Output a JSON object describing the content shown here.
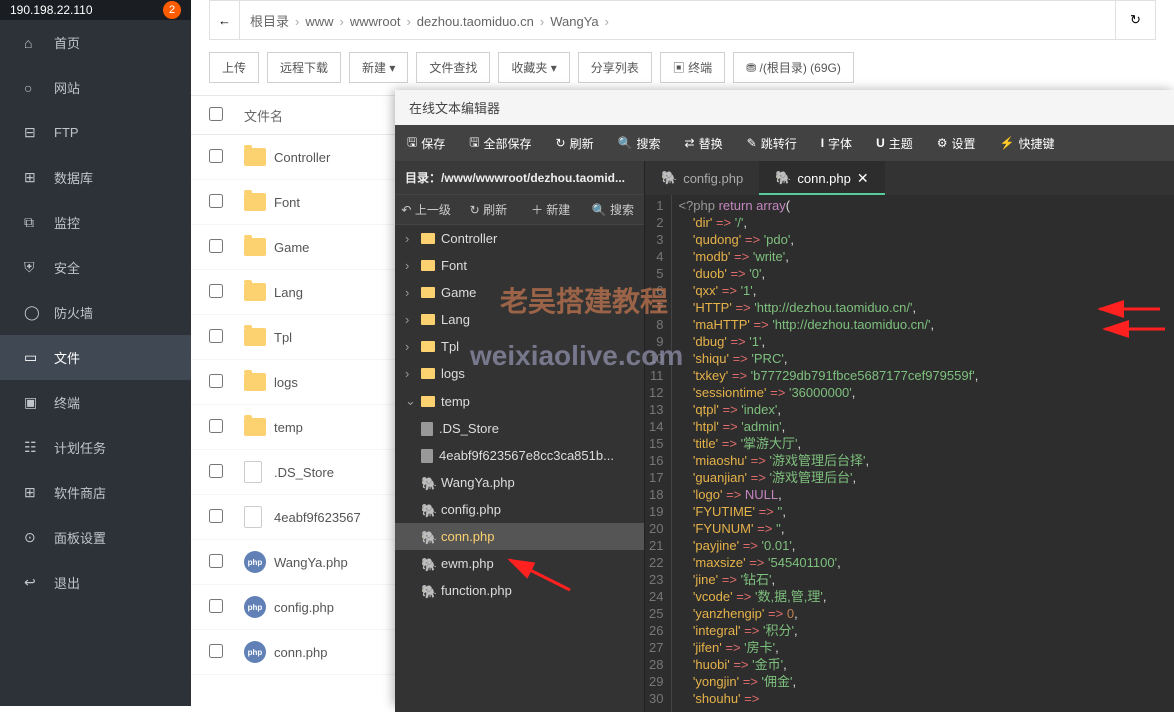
{
  "sidebar": {
    "ip": "190.198.22.110",
    "badge": "2",
    "items": [
      {
        "id": "home",
        "label": "首页",
        "icon": "⌂"
      },
      {
        "id": "site",
        "label": "网站",
        "icon": "○",
        "active": false
      },
      {
        "id": "ftp",
        "label": "FTP",
        "icon": "⊟"
      },
      {
        "id": "db",
        "label": "数据库",
        "icon": "⊞"
      },
      {
        "id": "monitor",
        "label": "监控",
        "icon": "⧉"
      },
      {
        "id": "security",
        "label": "安全",
        "icon": "⛨"
      },
      {
        "id": "firewall",
        "label": "防火墙",
        "icon": "◯"
      },
      {
        "id": "files",
        "label": "文件",
        "icon": "▭",
        "active": true
      },
      {
        "id": "terminal",
        "label": "终端",
        "icon": "▣"
      },
      {
        "id": "cron",
        "label": "计划任务",
        "icon": "☷"
      },
      {
        "id": "soft",
        "label": "软件商店",
        "icon": "⊞"
      },
      {
        "id": "panel",
        "label": "面板设置",
        "icon": "⊙"
      },
      {
        "id": "logout",
        "label": "退出",
        "icon": "↩"
      }
    ]
  },
  "breadcrumb": [
    "根目录",
    "www",
    "wwwroot",
    "dezhou.taomiduo.cn",
    "WangYa"
  ],
  "toolbar": {
    "upload": "上传",
    "remote": "远程下载",
    "new": "新建 ▾",
    "search": "文件查找",
    "fav": "收藏夹 ▾",
    "share": "分享列表",
    "term": "▣ 终端",
    "disk": "⛃ /(根目录) (69G)"
  },
  "cols": {
    "name": "文件名"
  },
  "files": [
    {
      "type": "folder",
      "name": "Controller"
    },
    {
      "type": "folder",
      "name": "Font"
    },
    {
      "type": "folder",
      "name": "Game"
    },
    {
      "type": "folder",
      "name": "Lang"
    },
    {
      "type": "folder",
      "name": "Tpl"
    },
    {
      "type": "folder",
      "name": "logs"
    },
    {
      "type": "folder",
      "name": "temp"
    },
    {
      "type": "file",
      "name": ".DS_Store"
    },
    {
      "type": "file",
      "name": "4eabf9f623567"
    },
    {
      "type": "php",
      "name": "WangYa.php"
    },
    {
      "type": "php",
      "name": "config.php"
    },
    {
      "type": "php",
      "name": "conn.php"
    }
  ],
  "editor": {
    "title": "在线文本编辑器",
    "bar": {
      "save": "保存",
      "saveall": "全部保存",
      "refresh": "刷新",
      "search": "搜索",
      "replace": "替换",
      "goto": "跳转行",
      "font": "字体",
      "theme": "主题",
      "settings": "设置",
      "shortcut": "快捷键"
    },
    "dir": "目录：/www/wwwroot/dezhou.taomid...",
    "tb": {
      "up": "上一级",
      "refresh": "刷新",
      "new": "新建",
      "search": "搜索"
    },
    "tree": [
      {
        "type": "folder",
        "name": "Controller",
        "caret": "›"
      },
      {
        "type": "folder",
        "name": "Font",
        "caret": "›"
      },
      {
        "type": "folder",
        "name": "Game",
        "caret": "›"
      },
      {
        "type": "folder",
        "name": "Lang",
        "caret": "›"
      },
      {
        "type": "folder",
        "name": "Tpl",
        "caret": "›"
      },
      {
        "type": "folder",
        "name": "logs",
        "caret": "›"
      },
      {
        "type": "folder",
        "name": "temp",
        "caret": "⌄"
      },
      {
        "type": "file",
        "name": ".DS_Store"
      },
      {
        "type": "file",
        "name": "4eabf9f623567e8cc3ca851b..."
      },
      {
        "type": "php",
        "name": "WangYa.php"
      },
      {
        "type": "php",
        "name": "config.php"
      },
      {
        "type": "php",
        "name": "conn.php",
        "sel": true
      },
      {
        "type": "php",
        "name": "ewm.php"
      },
      {
        "type": "php",
        "name": "function.php"
      }
    ],
    "tabs": [
      {
        "name": "config.php"
      },
      {
        "name": "conn.php",
        "active": true,
        "close": true
      }
    ],
    "code": [
      [
        [
          "k-tag",
          "<?php "
        ],
        [
          "k-kw",
          "return "
        ],
        [
          "k-kw",
          "array"
        ],
        [
          "",
          ""
        ],
        [
          "",
          "("
        ]
      ],
      [
        [
          "s-dot",
          "    "
        ],
        [
          "k-key",
          "'dir'"
        ],
        [
          "s-dot",
          " "
        ],
        [
          "k-op",
          "=>"
        ],
        [
          "s-dot",
          " "
        ],
        [
          "k-str",
          "'/'"
        ],
        [
          "",
          ","
        ]
      ],
      [
        [
          "s-dot",
          "    "
        ],
        [
          "k-key",
          "'qudong'"
        ],
        [
          "s-dot",
          " "
        ],
        [
          "k-op",
          "=>"
        ],
        [
          "s-dot",
          " "
        ],
        [
          "k-str",
          "'pdo'"
        ],
        [
          "",
          ","
        ]
      ],
      [
        [
          "s-dot",
          "    "
        ],
        [
          "k-key",
          "'modb'"
        ],
        [
          "s-dot",
          " "
        ],
        [
          "k-op",
          "=>"
        ],
        [
          "s-dot",
          " "
        ],
        [
          "k-str",
          "'write'"
        ],
        [
          "",
          ","
        ]
      ],
      [
        [
          "s-dot",
          "    "
        ],
        [
          "k-key",
          "'duob'"
        ],
        [
          "s-dot",
          " "
        ],
        [
          "k-op",
          "=>"
        ],
        [
          "s-dot",
          " "
        ],
        [
          "k-str",
          "'0'"
        ],
        [
          "",
          ","
        ]
      ],
      [
        [
          "s-dot",
          "    "
        ],
        [
          "k-key",
          "'qxx'"
        ],
        [
          "s-dot",
          " "
        ],
        [
          "k-op",
          "=>"
        ],
        [
          "s-dot",
          " "
        ],
        [
          "k-str",
          "'1'"
        ],
        [
          "",
          ","
        ]
      ],
      [
        [
          "s-dot",
          "    "
        ],
        [
          "k-key",
          "'HTTP'"
        ],
        [
          "s-dot",
          " "
        ],
        [
          "k-op",
          "=>"
        ],
        [
          "s-dot",
          " "
        ],
        [
          "k-str",
          "'http://dezhou.taomiduo.cn/'"
        ],
        [
          "",
          ","
        ]
      ],
      [
        [
          "s-dot",
          "    "
        ],
        [
          "k-key",
          "'maHTTP'"
        ],
        [
          "s-dot",
          " "
        ],
        [
          "k-op",
          "=>"
        ],
        [
          "s-dot",
          " "
        ],
        [
          "k-str",
          "'http://dezhou.taomiduo.cn/'"
        ],
        [
          "",
          ","
        ]
      ],
      [
        [
          "s-dot",
          "    "
        ],
        [
          "k-key",
          "'dbug'"
        ],
        [
          "s-dot",
          " "
        ],
        [
          "k-op",
          "=>"
        ],
        [
          "s-dot",
          " "
        ],
        [
          "k-str",
          "'1'"
        ],
        [
          "",
          ","
        ]
      ],
      [
        [
          "s-dot",
          "    "
        ],
        [
          "k-key",
          "'shiqu'"
        ],
        [
          "s-dot",
          " "
        ],
        [
          "k-op",
          "=>"
        ],
        [
          "s-dot",
          " "
        ],
        [
          "k-str",
          "'PRC'"
        ],
        [
          "",
          ","
        ]
      ],
      [
        [
          "s-dot",
          "    "
        ],
        [
          "k-key",
          "'txkey'"
        ],
        [
          "s-dot",
          " "
        ],
        [
          "k-op",
          "=>"
        ],
        [
          "s-dot",
          " "
        ],
        [
          "k-str",
          "'b77729db791fbce5687177cef979559f'"
        ],
        [
          "",
          ","
        ]
      ],
      [
        [
          "s-dot",
          "    "
        ],
        [
          "k-key",
          "'sessiontime'"
        ],
        [
          "s-dot",
          " "
        ],
        [
          "k-op",
          "=>"
        ],
        [
          "s-dot",
          " "
        ],
        [
          "k-str",
          "'36000000'"
        ],
        [
          "",
          ","
        ]
      ],
      [
        [
          "s-dot",
          "    "
        ],
        [
          "k-key",
          "'qtpl'"
        ],
        [
          "s-dot",
          " "
        ],
        [
          "k-op",
          "=>"
        ],
        [
          "s-dot",
          " "
        ],
        [
          "k-str",
          "'index'"
        ],
        [
          "",
          ","
        ]
      ],
      [
        [
          "s-dot",
          "    "
        ],
        [
          "k-key",
          "'htpl'"
        ],
        [
          "s-dot",
          " "
        ],
        [
          "k-op",
          "=>"
        ],
        [
          "s-dot",
          " "
        ],
        [
          "k-str",
          "'admin'"
        ],
        [
          "",
          ","
        ]
      ],
      [
        [
          "s-dot",
          "    "
        ],
        [
          "k-key",
          "'title'"
        ],
        [
          "s-dot",
          " "
        ],
        [
          "k-op",
          "=>"
        ],
        [
          "s-dot",
          " "
        ],
        [
          "k-str",
          "'掌游大厅'"
        ],
        [
          "",
          ","
        ]
      ],
      [
        [
          "s-dot",
          "    "
        ],
        [
          "k-key",
          "'miaoshu'"
        ],
        [
          "s-dot",
          " "
        ],
        [
          "k-op",
          "=>"
        ],
        [
          "s-dot",
          " "
        ],
        [
          "k-str",
          "'游戏管理后台择'"
        ],
        [
          "",
          ","
        ]
      ],
      [
        [
          "s-dot",
          "    "
        ],
        [
          "k-key",
          "'guanjian'"
        ],
        [
          "s-dot",
          " "
        ],
        [
          "k-op",
          "=>"
        ],
        [
          "s-dot",
          " "
        ],
        [
          "k-str",
          "'游戏管理后台'"
        ],
        [
          "",
          ","
        ]
      ],
      [
        [
          "s-dot",
          "    "
        ],
        [
          "k-key",
          "'logo'"
        ],
        [
          "s-dot",
          " "
        ],
        [
          "k-op",
          "=>"
        ],
        [
          "s-dot",
          " "
        ],
        [
          "k-kw",
          "NULL"
        ],
        [
          "",
          ","
        ]
      ],
      [
        [
          "s-dot",
          "    "
        ],
        [
          "k-key",
          "'FYUTIME'"
        ],
        [
          "s-dot",
          " "
        ],
        [
          "k-op",
          "=>"
        ],
        [
          "s-dot",
          " "
        ],
        [
          "k-str",
          "''"
        ],
        [
          "",
          ","
        ]
      ],
      [
        [
          "s-dot",
          "    "
        ],
        [
          "k-key",
          "'FYUNUM'"
        ],
        [
          "s-dot",
          " "
        ],
        [
          "k-op",
          "=>"
        ],
        [
          "s-dot",
          " "
        ],
        [
          "k-str",
          "''"
        ],
        [
          "",
          ","
        ]
      ],
      [
        [
          "s-dot",
          "    "
        ],
        [
          "k-key",
          "'payjine'"
        ],
        [
          "s-dot",
          " "
        ],
        [
          "k-op",
          "=>"
        ],
        [
          "s-dot",
          " "
        ],
        [
          "k-str",
          "'0.01'"
        ],
        [
          "",
          ","
        ]
      ],
      [
        [
          "s-dot",
          "    "
        ],
        [
          "k-key",
          "'maxsize'"
        ],
        [
          "s-dot",
          " "
        ],
        [
          "k-op",
          "=>"
        ],
        [
          "s-dot",
          " "
        ],
        [
          "k-str",
          "'545401100'"
        ],
        [
          "",
          ","
        ]
      ],
      [
        [
          "s-dot",
          "    "
        ],
        [
          "k-key",
          "'jine'"
        ],
        [
          "s-dot",
          " "
        ],
        [
          "k-op",
          "=>"
        ],
        [
          "s-dot",
          " "
        ],
        [
          "k-str",
          "'钻石'"
        ],
        [
          "",
          ","
        ]
      ],
      [
        [
          "s-dot",
          "    "
        ],
        [
          "k-key",
          "'vcode'"
        ],
        [
          "s-dot",
          " "
        ],
        [
          "k-op",
          "=>"
        ],
        [
          "s-dot",
          " "
        ],
        [
          "k-str",
          "'数,据,管,理'"
        ],
        [
          "",
          ","
        ]
      ],
      [
        [
          "s-dot",
          "    "
        ],
        [
          "k-key",
          "'yanzhengip'"
        ],
        [
          "s-dot",
          " "
        ],
        [
          "k-op",
          "=>"
        ],
        [
          "s-dot",
          " "
        ],
        [
          "k-num",
          "0"
        ],
        [
          "",
          ","
        ]
      ],
      [
        [
          "s-dot",
          "    "
        ],
        [
          "k-key",
          "'integral'"
        ],
        [
          "s-dot",
          " "
        ],
        [
          "k-op",
          "=>"
        ],
        [
          "s-dot",
          " "
        ],
        [
          "k-str",
          "'积分'"
        ],
        [
          "",
          ","
        ]
      ],
      [
        [
          "s-dot",
          "    "
        ],
        [
          "k-key",
          "'jifen'"
        ],
        [
          "s-dot",
          " "
        ],
        [
          "k-op",
          "=>"
        ],
        [
          "s-dot",
          " "
        ],
        [
          "k-str",
          "'房卡'"
        ],
        [
          "",
          ","
        ]
      ],
      [
        [
          "s-dot",
          "    "
        ],
        [
          "k-key",
          "'huobi'"
        ],
        [
          "s-dot",
          " "
        ],
        [
          "k-op",
          "=>"
        ],
        [
          "s-dot",
          " "
        ],
        [
          "k-str",
          "'金币'"
        ],
        [
          "",
          ","
        ]
      ],
      [
        [
          "s-dot",
          "    "
        ],
        [
          "k-key",
          "'yongjin'"
        ],
        [
          "s-dot",
          " "
        ],
        [
          "k-op",
          "=>"
        ],
        [
          "s-dot",
          " "
        ],
        [
          "k-str",
          "'佣金'"
        ],
        [
          "",
          ","
        ]
      ],
      [
        [
          "s-dot",
          "    "
        ],
        [
          "k-key",
          "'shouhu'"
        ],
        [
          "s-dot",
          " "
        ],
        [
          "k-op",
          "=>"
        ],
        [
          "s-dot",
          " "
        ]
      ]
    ]
  },
  "watermarks": {
    "wm1": "老吴搭建教程",
    "wm2": "weixiaolive.com"
  }
}
